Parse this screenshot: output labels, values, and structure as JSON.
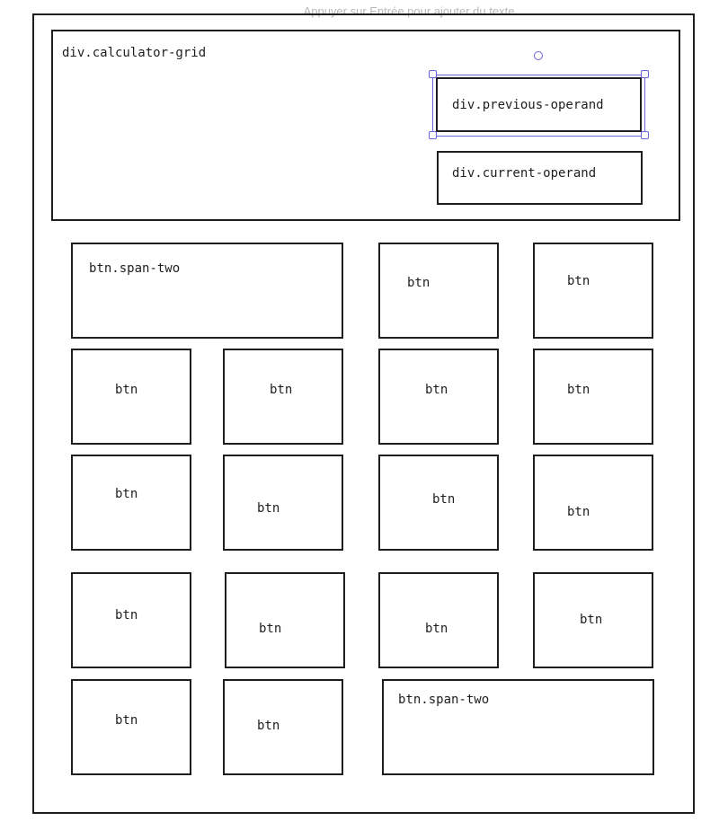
{
  "hint_text": "Appuyer sur Entrée pour ajouter du texte",
  "accent_color": "#6965db",
  "stroke_color": "#1e1e1e",
  "labels": {
    "calculator_grid": "div.calculator-grid",
    "previous_operand": "div.previous-operand",
    "current_operand": "div.current-operand",
    "span_two_top": "btn.span-two",
    "span_two_bottom": "btn.span-two",
    "btn": "btn"
  }
}
